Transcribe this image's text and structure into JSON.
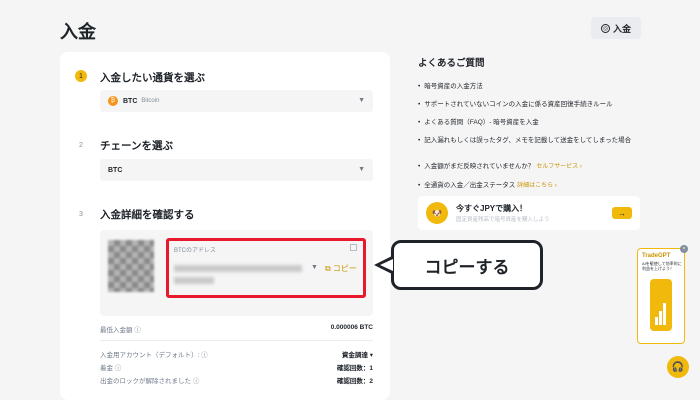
{
  "header": {
    "title": "入金",
    "deposit_button": "入金",
    "coin_glyph": "◎"
  },
  "steps": [
    {
      "number": "1",
      "label": "入金したい通貨を選ぶ"
    },
    {
      "number": "2",
      "label": "チェーンを選ぶ"
    },
    {
      "number": "3",
      "label": "入金詳細を確認する"
    }
  ],
  "coin_select": {
    "symbol": "BTC",
    "name": "Bitcoin",
    "icon_glyph": "₿"
  },
  "chain_select": {
    "value": "BTC"
  },
  "address": {
    "label": "BTCのアドレス",
    "copy_label": "コピー"
  },
  "details": {
    "min_deposit_label": "最低入金額",
    "min_deposit_value": "0.000006 BTC",
    "account_label": "入金用アカウント（デフォルト）:",
    "account_value": "資金調達",
    "credit_label": "着金",
    "credit_value": "確認回数：1",
    "unlock_label": "出金のロックが解除されました",
    "unlock_value": "確認回数：2"
  },
  "faq": {
    "title": "よくあるご質問",
    "items": [
      "暗号資産の入金方法",
      "サポートされていないコインの入金に係る資産回復手続きルール",
      "よくある質問（FAQ）- 暗号資産を入金",
      "記入漏れもしくは誤ったタグ、メモを記載して送金をしてしまった場合"
    ],
    "not_reflected_text": "入金額がまだ反映されていませんか？",
    "not_reflected_link": "セルフサービス",
    "status_text": "全通貨の入金／出金ステータス",
    "status_link": "詳細はこちら"
  },
  "promo": {
    "title": "今すぐJPYで購入！",
    "subtitle": "固定資産残高で暗号資産を購入しよう",
    "button_glyph": "→"
  },
  "callout": {
    "text": "コピーする"
  },
  "trade_ad": {
    "title": "TradeGPT",
    "subtitle": "AIを駆使して効率的に利益を上げよう！"
  },
  "colors": {
    "accent": "#f0b90b",
    "highlight_border": "#e8192c"
  }
}
